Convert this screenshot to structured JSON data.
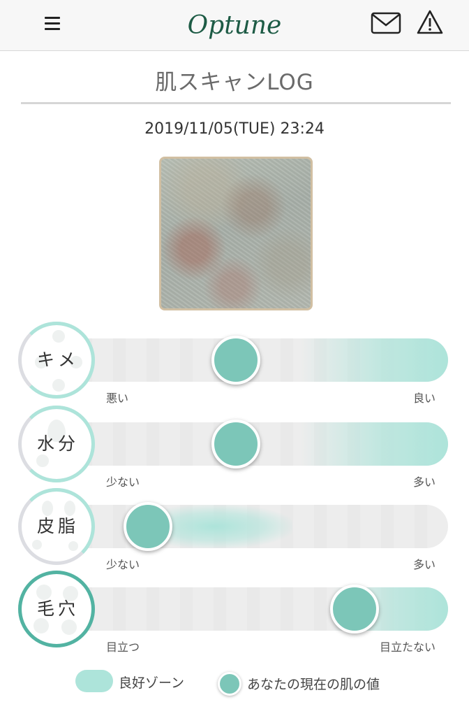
{
  "header": {
    "logo_text": "Optune",
    "menu_icon": "hamburger-menu-icon",
    "mail_icon": "mail-icon",
    "warning_icon": "warning-icon"
  },
  "page": {
    "title": "肌スキャンLOG",
    "datetime": "2019/11/05(TUE) 23:24"
  },
  "colors": {
    "accent": "#7cc6b8",
    "good_zone": "#ade4da",
    "ring_gray": "#dcdde2",
    "ring_active": "#52b3a2"
  },
  "metrics": [
    {
      "label": "キメ",
      "low": "悪い",
      "high": "良い",
      "value": 0.455,
      "zone": [
        0.62,
        1.0
      ],
      "zone_style": "right"
    },
    {
      "label": "水分",
      "low": "少ない",
      "high": "多い",
      "value": 0.455,
      "zone": [
        0.62,
        1.0
      ],
      "zone_style": "right"
    },
    {
      "label": "皮脂",
      "low": "少ない",
      "high": "多い",
      "value": 0.23,
      "zone": [
        0.2,
        0.6
      ],
      "zone_style": "center"
    },
    {
      "label": "毛穴",
      "low": "目立つ",
      "high": "目立たない",
      "value": 0.76,
      "zone": [
        0.7,
        1.0
      ],
      "zone_style": "right"
    }
  ],
  "legend": {
    "good_zone_label": "良好ゾーン",
    "your_value_label": "あなたの現在の肌の値"
  }
}
